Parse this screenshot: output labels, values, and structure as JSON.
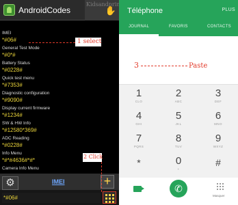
{
  "left_app": {
    "title": "AndroidCodes",
    "banner_text": "Kidsandprint",
    "items": [
      {
        "label": "IMEI",
        "code": "*#06#"
      },
      {
        "label": "General Test Mode",
        "code": "*#0*#"
      },
      {
        "label": "Battery Status",
        "code": "*#0228#"
      },
      {
        "label": "Quick test menu",
        "code": "*#7353#"
      },
      {
        "label": "Diagnostic configuration",
        "code": "*#9090#"
      },
      {
        "label": "Display current firmware",
        "code": "*#1234#"
      },
      {
        "label": "SW & HW Info",
        "code": "*#12580*369#"
      },
      {
        "label": "ADC Reading",
        "code": "*#0228#"
      },
      {
        "label": "Info Menu",
        "code": "*#*#4636#*#*"
      },
      {
        "label": "Camera Info Menu",
        "code": ""
      }
    ],
    "footer_link": "IMEI",
    "input_value": "*#06#",
    "colors": {
      "code": "#e8d23a",
      "label": "#dddddd",
      "link": "#6fa8ff"
    },
    "icons": {
      "app": "android-app-icon",
      "settings": "gear-icon",
      "add": "plus-icon",
      "keypad": "dialpad-icon"
    }
  },
  "annotations": {
    "step1": "1 select",
    "step2": "2 Click",
    "step3": "3",
    "paste": "Paste",
    "color": "#e23a2a"
  },
  "phone_app": {
    "title": "Téléphone",
    "plus_label": "PLUS",
    "tabs": [
      "JOURNAL",
      "FAVORIS",
      "CONTACTS"
    ],
    "active_tab": "JOURNAL",
    "keys": [
      {
        "digit": "1",
        "letters": "CLO"
      },
      {
        "digit": "2",
        "letters": "ABC"
      },
      {
        "digit": "3",
        "letters": "DEF"
      },
      {
        "digit": "4",
        "letters": "GHI"
      },
      {
        "digit": "5",
        "letters": "JKL"
      },
      {
        "digit": "6",
        "letters": "MNO"
      },
      {
        "digit": "7",
        "letters": "PQRS"
      },
      {
        "digit": "8",
        "letters": "TUV"
      },
      {
        "digit": "9",
        "letters": "WXYZ"
      },
      {
        "digit": "*",
        "letters": ""
      },
      {
        "digit": "0",
        "letters": "+"
      },
      {
        "digit": "#",
        "letters": ""
      }
    ],
    "hide_label": "Masquer",
    "colors": {
      "accent": "#26a45a",
      "keypad_bg": "#f1f1f1"
    },
    "icons": {
      "video": "video-call-icon",
      "call": "phone-call-icon",
      "hide": "dialpad-hide-icon"
    }
  }
}
